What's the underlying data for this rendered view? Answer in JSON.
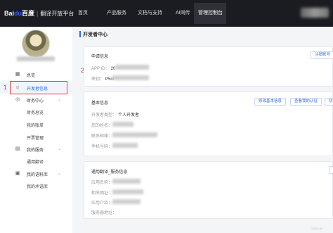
{
  "nav": {
    "brand": "Bai",
    "brand_paw": "du",
    "brand_cn": "百度",
    "product": "翻译开放平台",
    "items": [
      "首页",
      "产品服务",
      "文档与支持",
      "AI同传"
    ],
    "active": "管理控制台"
  },
  "sidebar": {
    "items": [
      {
        "label": "总览",
        "icon": "grid-icon"
      },
      {
        "label": "开发者信息",
        "icon": "user-icon"
      },
      {
        "label": "财务中心",
        "icon": "finance-icon"
      },
      {
        "label": "财务总览"
      },
      {
        "label": "我的账单"
      },
      {
        "label": "开票管理"
      },
      {
        "label": "我的服务",
        "icon": "document-icon"
      },
      {
        "label": "通用翻译"
      },
      {
        "label": "我的语料库",
        "icon": "library-icon"
      },
      {
        "label": "我的术语库"
      }
    ]
  },
  "main": {
    "title": "开发者中心",
    "apply": {
      "heading": "申请信息",
      "appid_label": "APP ID：",
      "appid_value": "20",
      "secret_label": "密钥：",
      "secret_value": "P5m",
      "cancel_button": "注销账号"
    },
    "basic": {
      "heading": "基本信息",
      "type_label": "开发者类型：",
      "type_value": "个人开发者",
      "name_label": "您的姓名：",
      "email_label": "联系邮箱：",
      "phone_label": "手机号码：",
      "btn_edit": "修改基本信息",
      "btn_auth": "查看我的认证",
      "btn_switch": "切换"
    },
    "service": {
      "heading": "通用翻译_服务信息",
      "app_name": "应用名称：",
      "app_url": "相关网址：",
      "app_desc": "应用介绍：",
      "server_addr": "服务器地址："
    }
  },
  "annotations": {
    "one": "1",
    "two": "2"
  },
  "watermark": "CSDN @..."
}
